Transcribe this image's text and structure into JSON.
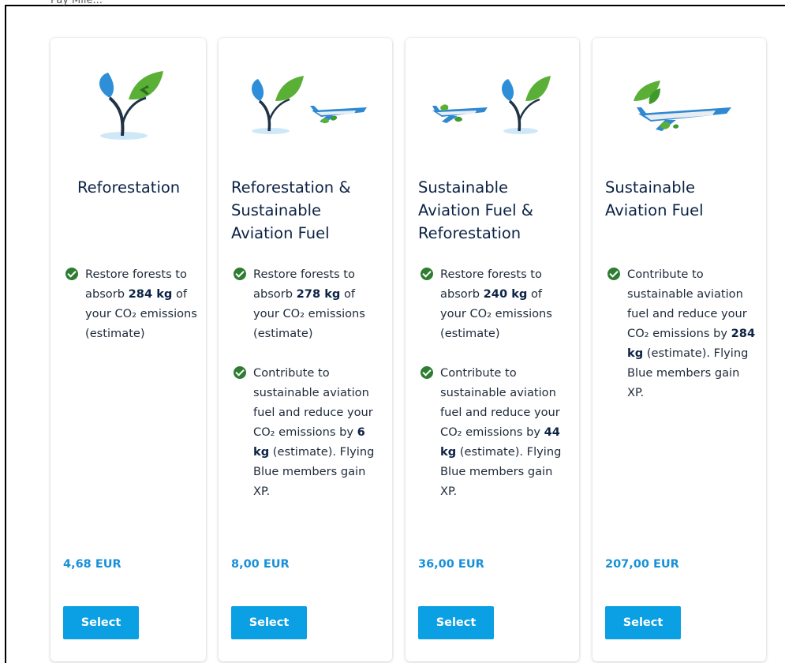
{
  "page": {
    "cropped_heading": "Pay Mile..."
  },
  "options": [
    {
      "title_lines": [
        "Reforestation"
      ],
      "benefit_1": {
        "pre": "Restore forests to absorb ",
        "bold": "284 kg",
        "post": " of your CO₂ emissions (estimate)"
      },
      "price": "4,68 EUR",
      "button": "Select",
      "illustration": "sapling-icon"
    },
    {
      "title_lines": [
        "Reforestation &",
        "Sustainable",
        "Aviation Fuel"
      ],
      "benefit_1": {
        "pre": "Restore forests to absorb ",
        "bold": "278 kg",
        "post": " of your CO₂ emissions (estimate)"
      },
      "benefit_2": {
        "pre": "Contribute to sustainable aviation fuel and reduce your CO₂ emissions by ",
        "bold": "6 kg",
        "post": " (estimate). Flying Blue members gain XP."
      },
      "price": "8,00 EUR",
      "button": "Select",
      "illustration": "sapling-and-plane-icon"
    },
    {
      "title_lines": [
        "Sustainable",
        "Aviation Fuel &",
        "Reforestation"
      ],
      "benefit_1": {
        "pre": "Restore forests to absorb ",
        "bold": "240 kg",
        "post": " of your CO₂ emissions (estimate)"
      },
      "benefit_2": {
        "pre": "Contribute to sustainable aviation fuel and reduce your CO₂ emissions by ",
        "bold": "44 kg",
        "post": " (estimate). Flying Blue members gain XP."
      },
      "price": "36,00 EUR",
      "button": "Select",
      "illustration": "plane-and-sapling-icon"
    },
    {
      "title_lines": [
        "Sustainable",
        "Aviation Fuel"
      ],
      "benefit_1": {
        "pre": "Contribute to sustainable aviation fuel and reduce your CO₂ emissions by ",
        "bold": "284 kg",
        "post": " (estimate). Flying Blue members gain XP."
      },
      "price": "207,00 EUR",
      "button": "Select",
      "illustration": "plane-with-leaves-icon"
    }
  ],
  "colors": {
    "accent": "#0b9fe3",
    "price": "#1890d8",
    "check": "#2e7d32",
    "title": "#0d2346"
  }
}
